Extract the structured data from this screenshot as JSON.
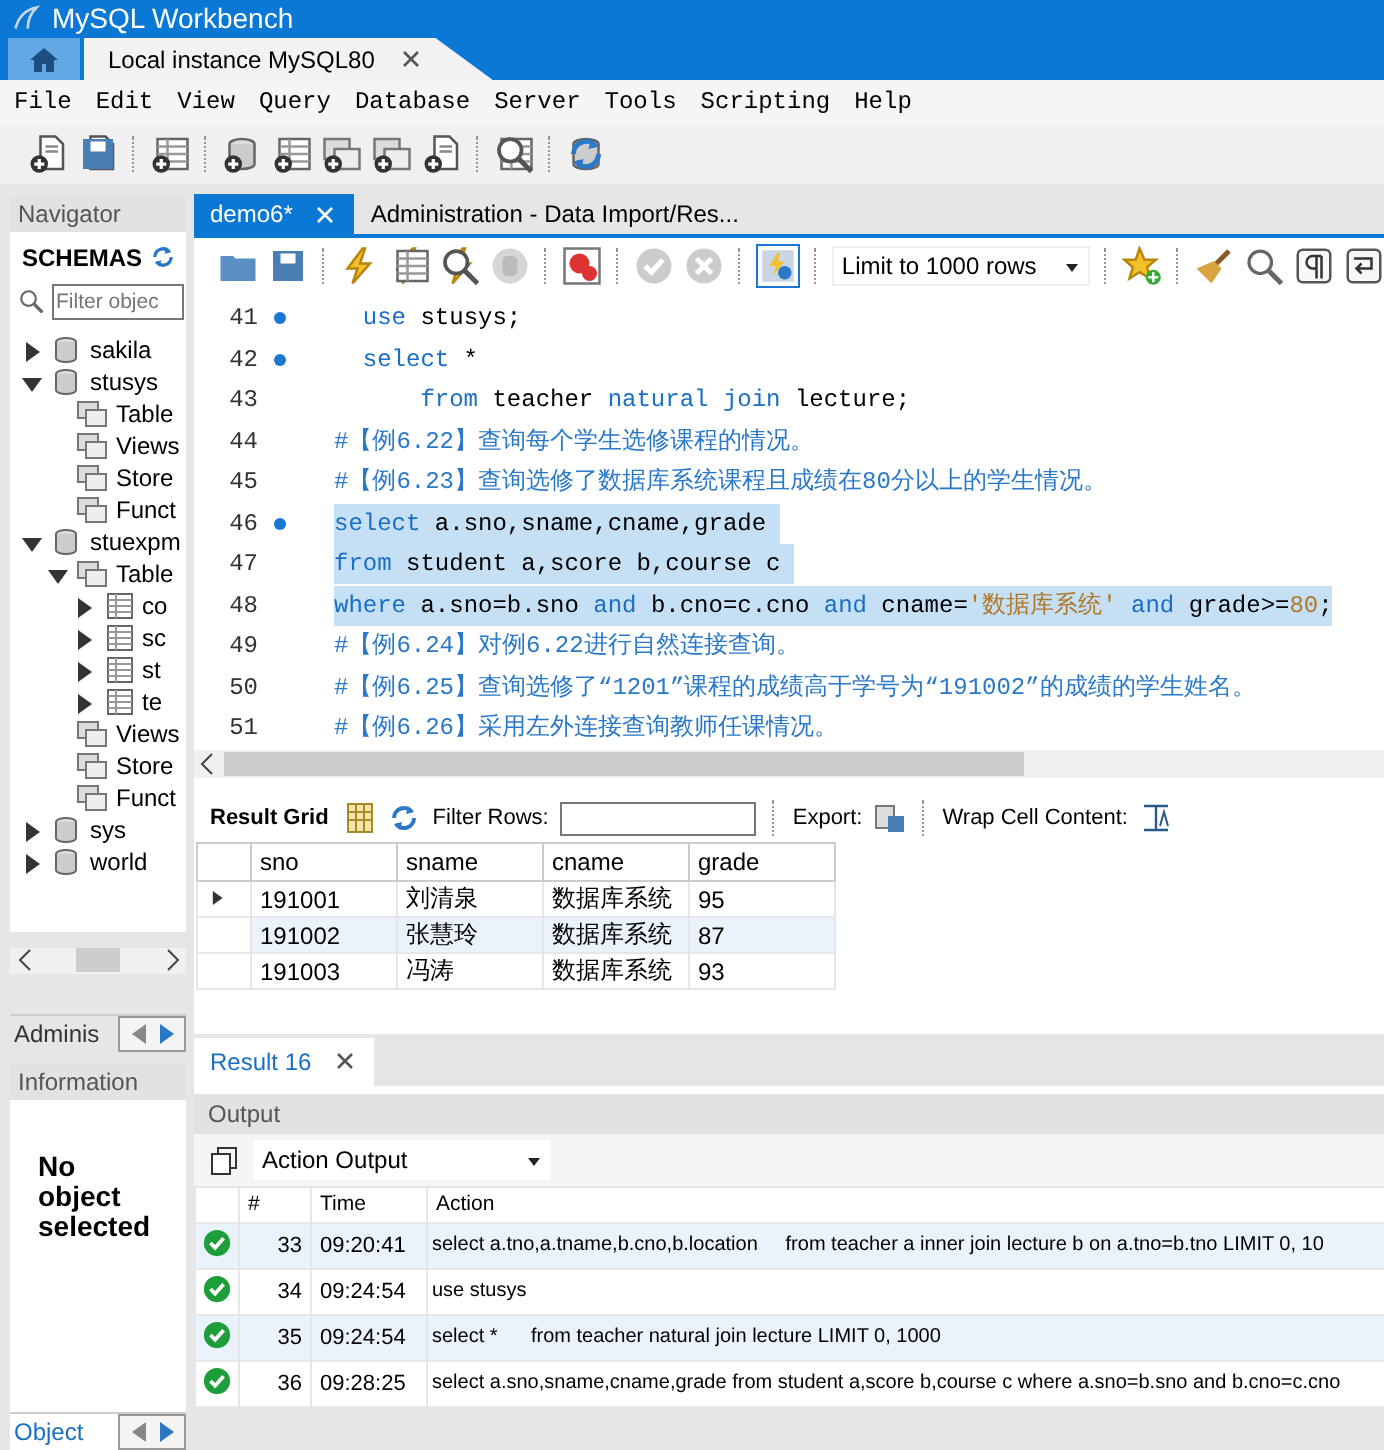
{
  "window": {
    "title": "MySQL Workbench"
  },
  "connection_tabs": [
    {
      "label": "Local instance MySQL80",
      "selected": true
    }
  ],
  "menu": [
    "File",
    "Edit",
    "View",
    "Query",
    "Database",
    "Server",
    "Tools",
    "Scripting",
    "Help"
  ],
  "navigator": {
    "title": "Navigator",
    "section": "SCHEMAS",
    "filter": {
      "placeholder": "Filter objec"
    },
    "tree": [
      {
        "label": "sakila",
        "kind": "schema",
        "expanded": false
      },
      {
        "label": "stusys",
        "kind": "schema",
        "expanded": true,
        "children": [
          {
            "label": "Table",
            "kind": "group"
          },
          {
            "label": "Views",
            "kind": "group"
          },
          {
            "label": "Store",
            "kind": "group"
          },
          {
            "label": "Funct",
            "kind": "group"
          }
        ]
      },
      {
        "label": "stuexpm",
        "kind": "schema",
        "expanded": true,
        "children": [
          {
            "label": "Table",
            "kind": "group",
            "expanded": true,
            "children": [
              {
                "label": "co",
                "kind": "table",
                "expanded": false
              },
              {
                "label": "sc",
                "kind": "table",
                "expanded": false
              },
              {
                "label": "st",
                "kind": "table",
                "expanded": false
              },
              {
                "label": "te",
                "kind": "table",
                "expanded": false
              }
            ]
          },
          {
            "label": "Views",
            "kind": "group"
          },
          {
            "label": "Store",
            "kind": "group"
          },
          {
            "label": "Funct",
            "kind": "group"
          }
        ]
      },
      {
        "label": "sys",
        "kind": "schema",
        "expanded": false
      },
      {
        "label": "world",
        "kind": "schema",
        "expanded": false
      }
    ],
    "bottom_tab": "Adminis"
  },
  "information": {
    "title": "Information",
    "message": "No object selected",
    "bottom_tab": "Object"
  },
  "editor_tabs": [
    {
      "label": "demo6*",
      "selected": true
    },
    {
      "label": "Administration - Data Import/Res...",
      "selected": false
    }
  ],
  "sql_toolbar": {
    "auto_commit": true,
    "limit": "Limit to 1000 rows"
  },
  "editor": {
    "lines": [
      {
        "number": "41",
        "marker": true,
        "selected": false,
        "tokens": [
          {
            "kind": "keyword",
            "text": "  use"
          },
          {
            "kind": "plain",
            "text": " stusys;"
          }
        ]
      },
      {
        "number": "42",
        "marker": true,
        "selected": false,
        "tokens": [
          {
            "kind": "keyword",
            "text": "  select"
          },
          {
            "kind": "plain",
            "text": " *"
          }
        ]
      },
      {
        "number": "43",
        "marker": false,
        "selected": false,
        "tokens": [
          {
            "kind": "keyword",
            "text": "      from"
          },
          {
            "kind": "plain",
            "text": " teacher "
          },
          {
            "kind": "keyword",
            "text": "natural join"
          },
          {
            "kind": "plain",
            "text": " lecture;"
          }
        ]
      },
      {
        "number": "44",
        "marker": false,
        "selected": false,
        "tokens": [
          {
            "kind": "comment",
            "text": "#【例6.22】查询每个学生选修课程的情况。"
          }
        ]
      },
      {
        "number": "45",
        "marker": false,
        "selected": false,
        "tokens": [
          {
            "kind": "comment",
            "text": "#【例6.23】查询选修了数据库系统课程且成绩在80分以上的学生情况。"
          }
        ]
      },
      {
        "number": "46",
        "marker": true,
        "selected": true,
        "tokens": [
          {
            "kind": "keyword",
            "text": "select"
          },
          {
            "kind": "plain",
            "text": " a.sno,sname,cname,grade "
          }
        ]
      },
      {
        "number": "47",
        "marker": false,
        "selected": true,
        "tokens": [
          {
            "kind": "keyword",
            "text": "from"
          },
          {
            "kind": "plain",
            "text": " student a,score b,course c "
          }
        ]
      },
      {
        "number": "48",
        "marker": false,
        "selected": true,
        "tokens": [
          {
            "kind": "keyword",
            "text": "where"
          },
          {
            "kind": "plain",
            "text": " a.sno=b.sno "
          },
          {
            "kind": "keyword",
            "text": "and"
          },
          {
            "kind": "plain",
            "text": " b.cno=c.cno "
          },
          {
            "kind": "keyword",
            "text": "and"
          },
          {
            "kind": "plain",
            "text": " cname="
          },
          {
            "kind": "string",
            "text": "'数据库系统'"
          },
          {
            "kind": "keyword",
            "text": " and"
          },
          {
            "kind": "plain",
            "text": " grade>="
          },
          {
            "kind": "number",
            "text": "80"
          },
          {
            "kind": "plain",
            "text": ";"
          }
        ]
      },
      {
        "number": "49",
        "marker": false,
        "selected": false,
        "tokens": [
          {
            "kind": "comment",
            "text": "#【例6.24】对例6.22进行自然连接查询。"
          }
        ]
      },
      {
        "number": "50",
        "marker": false,
        "selected": false,
        "tokens": [
          {
            "kind": "comment",
            "text": "#【例6.25】查询选修了“1201”课程的成绩高于学号为“191002”的成绩的学生姓名。"
          }
        ]
      },
      {
        "number": "51",
        "marker": false,
        "selected": false,
        "tokens": [
          {
            "kind": "comment",
            "text": "#【例6.26】采用左外连接查询教师任课情况。"
          }
        ]
      }
    ]
  },
  "results": {
    "view_button": "Result Grid",
    "filter_label": "Filter Rows:",
    "export_label": "Export:",
    "wrap_label": "Wrap Cell Content:",
    "columns": [
      "sno",
      "sname",
      "cname",
      "grade"
    ],
    "rows": [
      {
        "current": true,
        "cells": [
          "191001",
          "刘清泉",
          "数据库系统",
          "95"
        ]
      },
      {
        "current": false,
        "cells": [
          "191002",
          "张慧玲",
          "数据库系统",
          "87"
        ]
      },
      {
        "current": false,
        "cells": [
          "191003",
          "冯涛",
          "数据库系统",
          "93"
        ]
      }
    ]
  },
  "result_tabs": [
    {
      "label": "Result 16",
      "selected": true
    }
  ],
  "output": {
    "title": "Output",
    "mode": "Action Output",
    "columns": [
      "#",
      "Time",
      "Action"
    ],
    "rows": [
      {
        "kind": "success",
        "number": "33",
        "time": "09:20:41",
        "action": "select a.tno,a.tname,b.cno,b.location     from teacher a inner join lecture b on a.tno=b.tno LIMIT 0, 10"
      },
      {
        "kind": "success",
        "number": "34",
        "time": "09:24:54",
        "action": "use stusys"
      },
      {
        "kind": "success",
        "number": "35",
        "time": "09:24:54",
        "action": "select *      from teacher natural join lecture LIMIT 0, 1000"
      },
      {
        "kind": "success",
        "number": "36",
        "time": "09:28:25",
        "action": "select a.sno,sname,cname,grade from student a,score b,course c where a.sno=b.sno and b.cno=c.cno"
      }
    ]
  }
}
